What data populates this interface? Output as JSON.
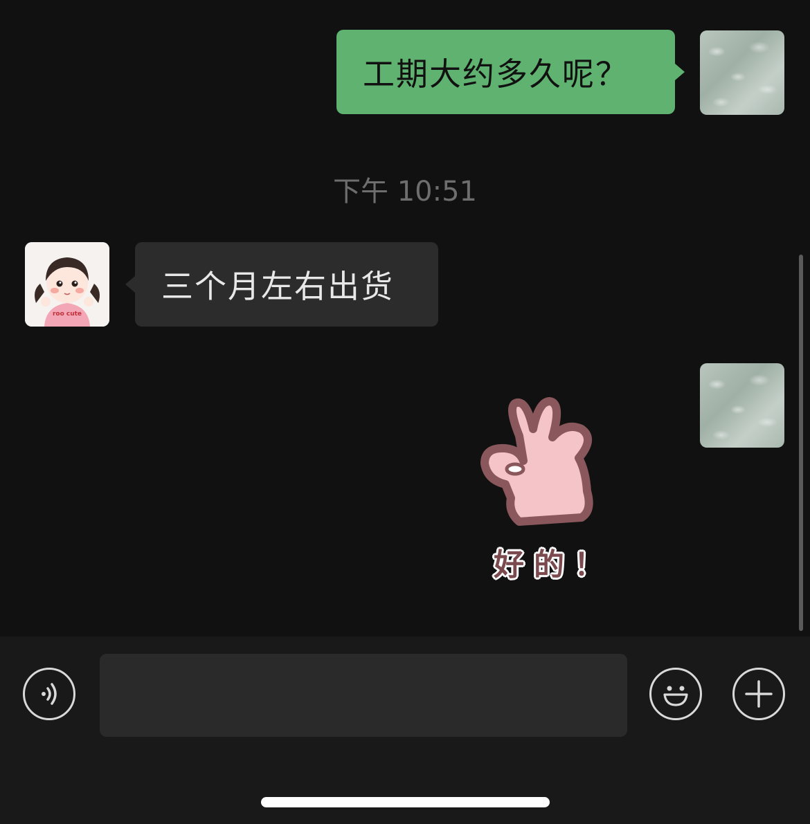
{
  "messages": [
    {
      "direction": "outgoing",
      "text": "工期大约多久呢？"
    },
    {
      "direction": "incoming",
      "text": "三个月左右出货"
    },
    {
      "direction": "outgoing",
      "type": "sticker",
      "text": "好的！"
    }
  ],
  "timestamp": "下午 10:51",
  "input": {
    "value": "",
    "placeholder": ""
  },
  "avatars": {
    "self": "water-ripple-avatar",
    "contact": "cartoon-girl-avatar",
    "contact_shirt_text": "roo cute"
  },
  "toolbar": {
    "voice_icon": "voice-icon",
    "emoji_icon": "emoji-icon",
    "plus_icon": "plus-icon"
  },
  "colors": {
    "background": "#111111",
    "outgoing_bubble": "#5fb26f",
    "incoming_bubble": "#2c2c2c",
    "input_bar": "#191919"
  }
}
